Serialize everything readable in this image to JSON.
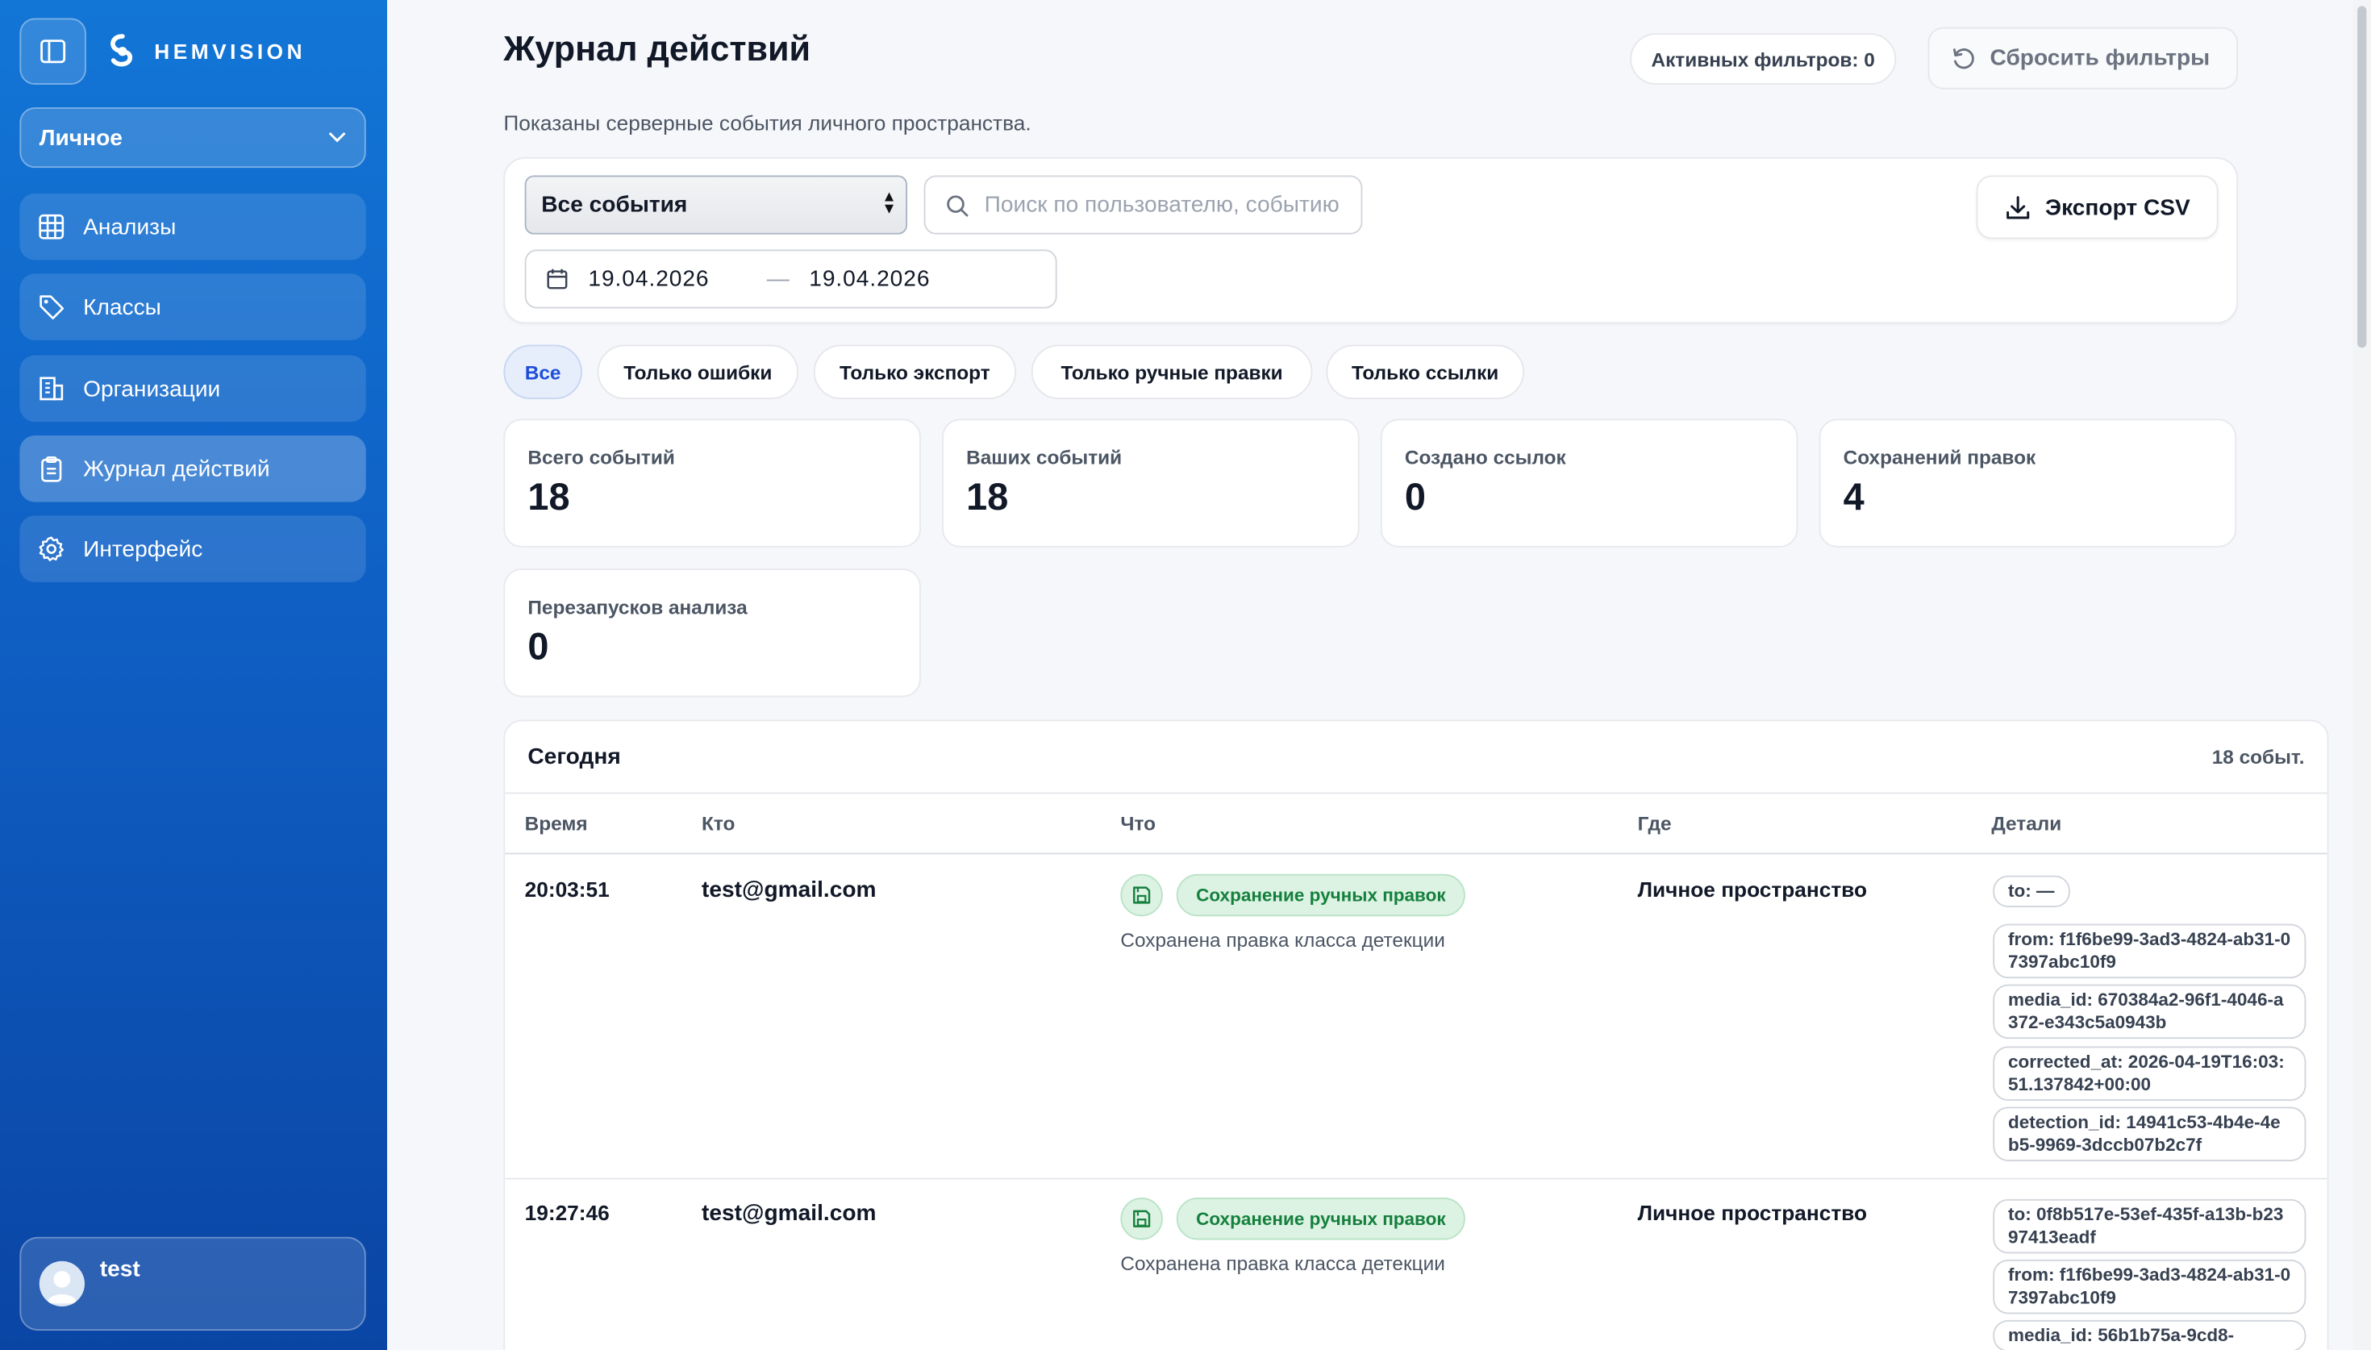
{
  "brand": {
    "name": "HEMVISION"
  },
  "workspace": {
    "selected": "Личное"
  },
  "sidebar": {
    "items": [
      {
        "label": "Анализы",
        "icon": "grid-icon"
      },
      {
        "label": "Классы",
        "icon": "tag-icon"
      },
      {
        "label": "Организации",
        "icon": "building-icon"
      },
      {
        "label": "Журнал действий",
        "icon": "clipboard-icon",
        "active": true
      },
      {
        "label": "Интерфейс",
        "icon": "gear-icon"
      }
    ],
    "user": {
      "name": "test"
    }
  },
  "header": {
    "title": "Журнал действий",
    "subtitle": "Показаны серверные события личного пространства.",
    "active_filters": "Активных фильтров: 0",
    "reset_label": "Сбросить фильтры"
  },
  "filters": {
    "event_type": "Все события",
    "search_placeholder": "Поиск по пользователю, событию",
    "date_from": "19.04.2026",
    "date_sep": "—",
    "date_to": "19.04.2026",
    "export_label": "Экспорт CSV"
  },
  "quick_filters": [
    {
      "label": "Все",
      "active": true
    },
    {
      "label": "Только ошибки"
    },
    {
      "label": "Только экспорт"
    },
    {
      "label": "Только ручные правки"
    },
    {
      "label": "Только ссылки"
    }
  ],
  "stats": [
    {
      "label": "Всего событий",
      "value": "18"
    },
    {
      "label": "Ваших событий",
      "value": "18"
    },
    {
      "label": "Создано ссылок",
      "value": "0"
    },
    {
      "label": "Сохранений правок",
      "value": "4"
    },
    {
      "label": "Перезапусков анализа",
      "value": "0"
    }
  ],
  "table": {
    "group_title": "Сегодня",
    "group_count": "18 событ.",
    "columns": [
      "Время",
      "Кто",
      "Что",
      "Где",
      "Детали"
    ],
    "rows": [
      {
        "time": "20:03:51",
        "who": "test@gmail.com",
        "badge": "Сохранение ручных правок",
        "desc": "Сохранена правка класса детекции",
        "where": "Личное пространство",
        "details": [
          "to: —",
          "from: f1f6be99-3ad3-4824-ab31-07397abc10f9",
          "media_id: 670384a2-96f1-4046-a372-e343c5a0943b",
          "corrected_at: 2026-04-19T16:03:51.137842+00:00",
          "detection_id: 14941c53-4b4e-4eb5-9969-3dccb07b2c7f"
        ]
      },
      {
        "time": "19:27:46",
        "who": "test@gmail.com",
        "badge": "Сохранение ручных правок",
        "desc": "Сохранена правка класса детекции",
        "where": "Личное пространство",
        "details": [
          "to: 0f8b517e-53ef-435f-a13b-b2397413eadf",
          "from: f1f6be99-3ad3-4824-ab31-07397abc10f9",
          "media_id: 56b1b75a-9cd8-"
        ]
      }
    ]
  },
  "colors": {
    "sidebar": "#0f5fc4",
    "accent": "#1d4ed8",
    "success": "#15803d"
  }
}
